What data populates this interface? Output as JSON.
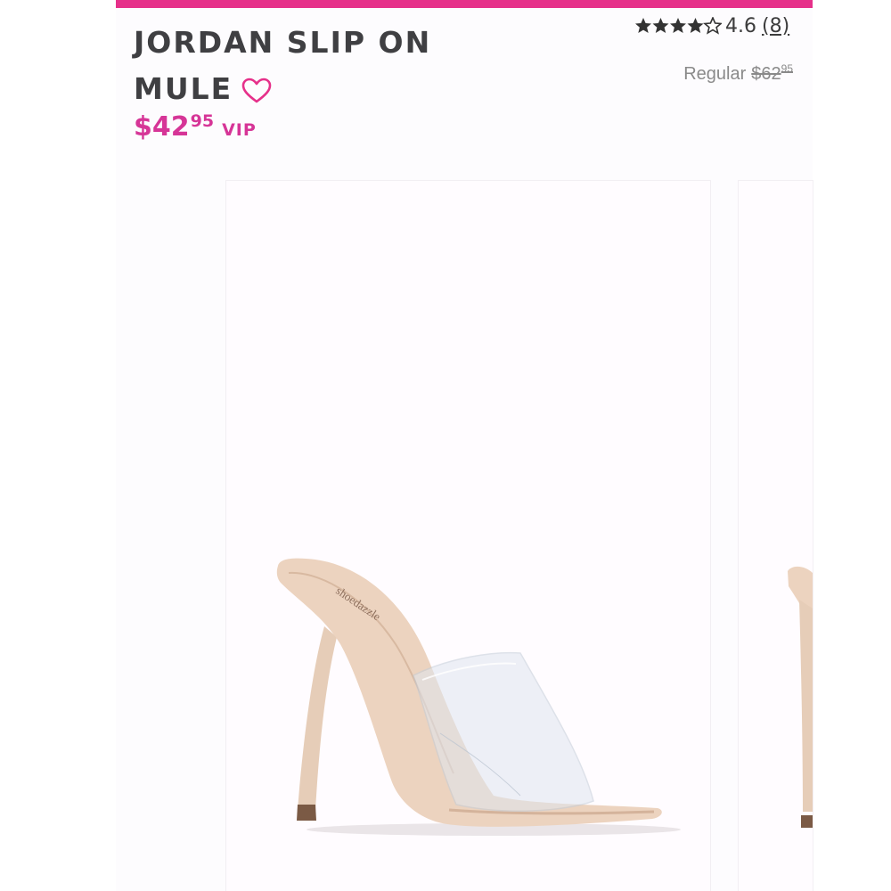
{
  "product": {
    "title_line1": "JORDAN SLIP ON",
    "title_line2": "MULE",
    "price_dollars": "$42",
    "price_cents": "95",
    "price_tag": "VIP",
    "rating_value": "4.6",
    "rating_count": "(8)",
    "rating_stars": 4.6,
    "regular_label": "Regular",
    "regular_dollars": "$62",
    "regular_cents": "95",
    "insole_brand": "shoedazzle"
  },
  "colors": {
    "accent_pink": "#e6308a",
    "price_pink": "#d63597",
    "title_gray": "#3f3f42",
    "shoe_nude": "#ecd3bf"
  },
  "icons": {
    "favorite": "heart-outline-icon",
    "rating": "star-icon"
  }
}
